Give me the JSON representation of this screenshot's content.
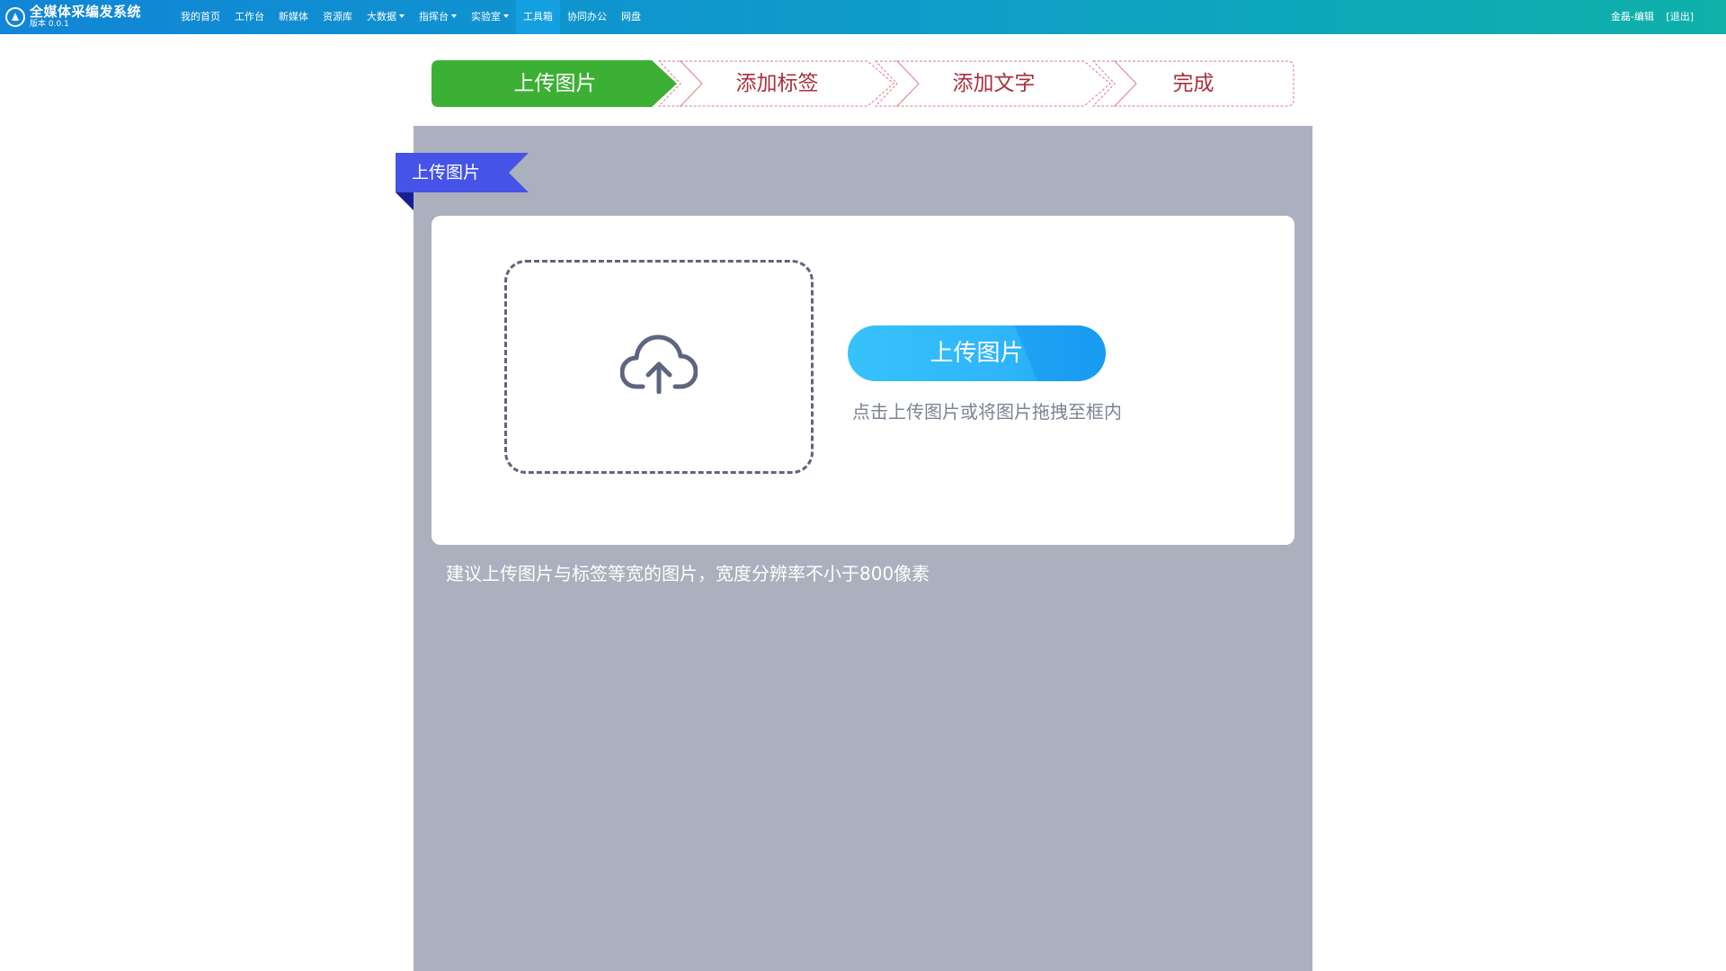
{
  "app": {
    "title": "全媒体采编发系统",
    "version": "版本 0.0.1"
  },
  "nav": {
    "items": [
      {
        "label": "我的首页"
      },
      {
        "label": "工作台"
      },
      {
        "label": "新媒体"
      },
      {
        "label": "资源库"
      },
      {
        "label": "大数据",
        "dropdown": true
      },
      {
        "label": "指挥台",
        "dropdown": true
      },
      {
        "label": "实验室",
        "dropdown": true
      },
      {
        "label": "工具箱",
        "active": true
      },
      {
        "label": "协同办公"
      },
      {
        "label": "网盘"
      }
    ]
  },
  "user": {
    "name": "金磊-编辑",
    "logout": "[退出]"
  },
  "steps": [
    {
      "label": "上传图片",
      "state": "current"
    },
    {
      "label": "添加标签",
      "state": "pending"
    },
    {
      "label": "添加文字",
      "state": "pending"
    },
    {
      "label": "完成",
      "state": "pending"
    }
  ],
  "section": {
    "ribbon_label": "上传图片"
  },
  "upload": {
    "dropzone_icon": "cloud-upload-icon",
    "button_label": "上传图片",
    "hint": "点击上传图片或将图片拖拽至框内"
  },
  "suggestion": "建议上传图片与标签等宽的图片，宽度分辨率不小于800像素",
  "colors": {
    "nav_start": "#1185d6",
    "nav_end": "#0fb1a9",
    "step_active": "#3cb034",
    "step_pending_text": "#a8303c",
    "step_pending_border": "#e07a88",
    "panel_bg": "#aab0bd",
    "ribbon": "#4553e8",
    "upload_button": "#2fb5fa"
  }
}
